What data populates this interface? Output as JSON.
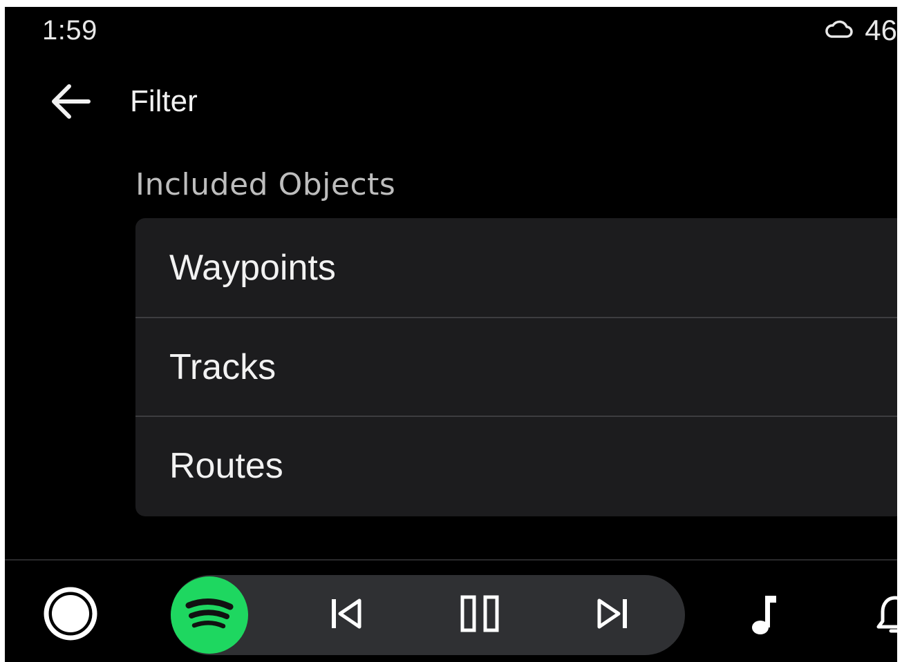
{
  "status_bar": {
    "time": "1:59",
    "weather_icon": "cloud-icon",
    "temperature": "46"
  },
  "header": {
    "back_icon": "arrow-back-icon",
    "title": "Filter"
  },
  "section": {
    "label": "Included Objects",
    "items": [
      {
        "label": "Waypoints"
      },
      {
        "label": "Tracks"
      },
      {
        "label": "Routes"
      }
    ]
  },
  "bottom_bar": {
    "home_icon": "home-circle-icon",
    "media_app_icon": "spotify-icon",
    "media_app_color": "#1ed760",
    "controls": [
      "skip-previous-icon",
      "pause-icon",
      "skip-next-icon"
    ],
    "music_icon": "music-note-icon",
    "notification_icon": "bell-icon"
  },
  "colors": {
    "background": "#000000",
    "list_background": "#1c1c1e",
    "pill_background": "#2f3033",
    "text_primary": "#f2f2f2",
    "text_secondary": "#bdbdbd"
  }
}
